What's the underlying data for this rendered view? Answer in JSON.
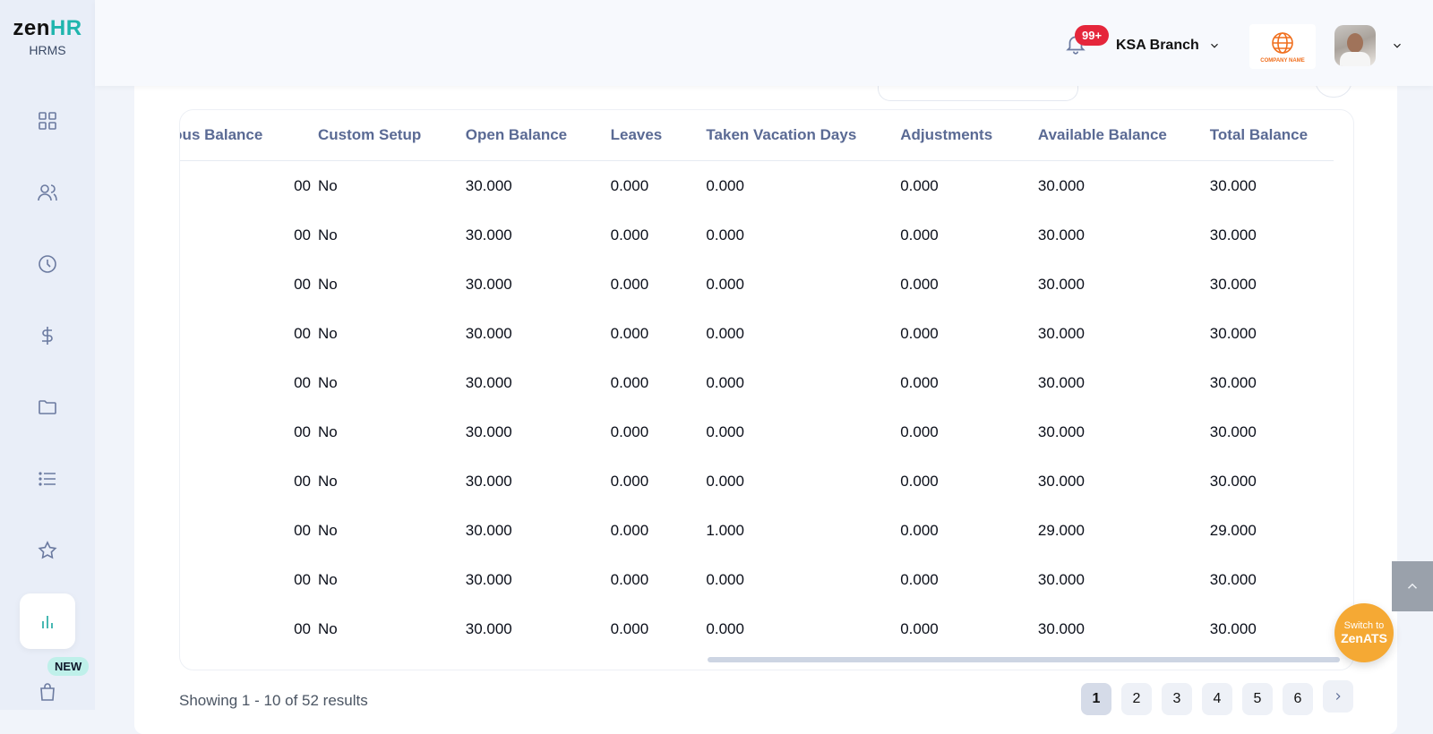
{
  "brand": {
    "name_main": "zen",
    "name_accent": "HR",
    "subtitle": "HRMS",
    "accent_color": "#1fb5ad"
  },
  "sidebar": {
    "items": [
      {
        "icon": "dashboard-grid-icon"
      },
      {
        "icon": "users-icon"
      },
      {
        "icon": "clock-icon"
      },
      {
        "icon": "dollar-icon"
      },
      {
        "icon": "folder-icon"
      },
      {
        "icon": "list-icon"
      },
      {
        "icon": "star-icon"
      },
      {
        "icon": "bar-chart-icon",
        "active": true
      },
      {
        "icon": "shopping-bag-icon"
      }
    ],
    "new_badge": "NEW"
  },
  "header": {
    "notification_count": "99+",
    "branch": "KSA Branch",
    "company_logo_text": "COMPANY NAME"
  },
  "table": {
    "columns": [
      {
        "label": "vious Balance"
      },
      {
        "label": "Custom Setup"
      },
      {
        "label": "Open Balance"
      },
      {
        "label": "Leaves"
      },
      {
        "label": "Taken Vacation Days"
      },
      {
        "label": "Adjustments"
      },
      {
        "label": "Available Balance"
      },
      {
        "label": "Total Balance"
      }
    ],
    "rows": [
      [
        "00",
        "No",
        "30.000",
        "0.000",
        "0.000",
        "0.000",
        "30.000",
        "30.000"
      ],
      [
        "00",
        "No",
        "30.000",
        "0.000",
        "0.000",
        "0.000",
        "30.000",
        "30.000"
      ],
      [
        "00",
        "No",
        "30.000",
        "0.000",
        "0.000",
        "0.000",
        "30.000",
        "30.000"
      ],
      [
        "00",
        "No",
        "30.000",
        "0.000",
        "0.000",
        "0.000",
        "30.000",
        "30.000"
      ],
      [
        "00",
        "No",
        "30.000",
        "0.000",
        "0.000",
        "0.000",
        "30.000",
        "30.000"
      ],
      [
        "00",
        "No",
        "30.000",
        "0.000",
        "0.000",
        "0.000",
        "30.000",
        "30.000"
      ],
      [
        "00",
        "No",
        "30.000",
        "0.000",
        "0.000",
        "0.000",
        "30.000",
        "30.000"
      ],
      [
        "00",
        "No",
        "30.000",
        "0.000",
        "1.000",
        "0.000",
        "29.000",
        "29.000"
      ],
      [
        "00",
        "No",
        "30.000",
        "0.000",
        "0.000",
        "0.000",
        "30.000",
        "30.000"
      ],
      [
        "00",
        "No",
        "30.000",
        "0.000",
        "0.000",
        "0.000",
        "30.000",
        "30.000"
      ]
    ]
  },
  "footer": {
    "results_text": "Showing 1 - 10 of 52 results",
    "pages": [
      "1",
      "2",
      "3",
      "4",
      "5",
      "6"
    ],
    "current_page": "1"
  },
  "floating": {
    "switch_line1": "Switch to",
    "switch_line2": "ZenATS"
  }
}
